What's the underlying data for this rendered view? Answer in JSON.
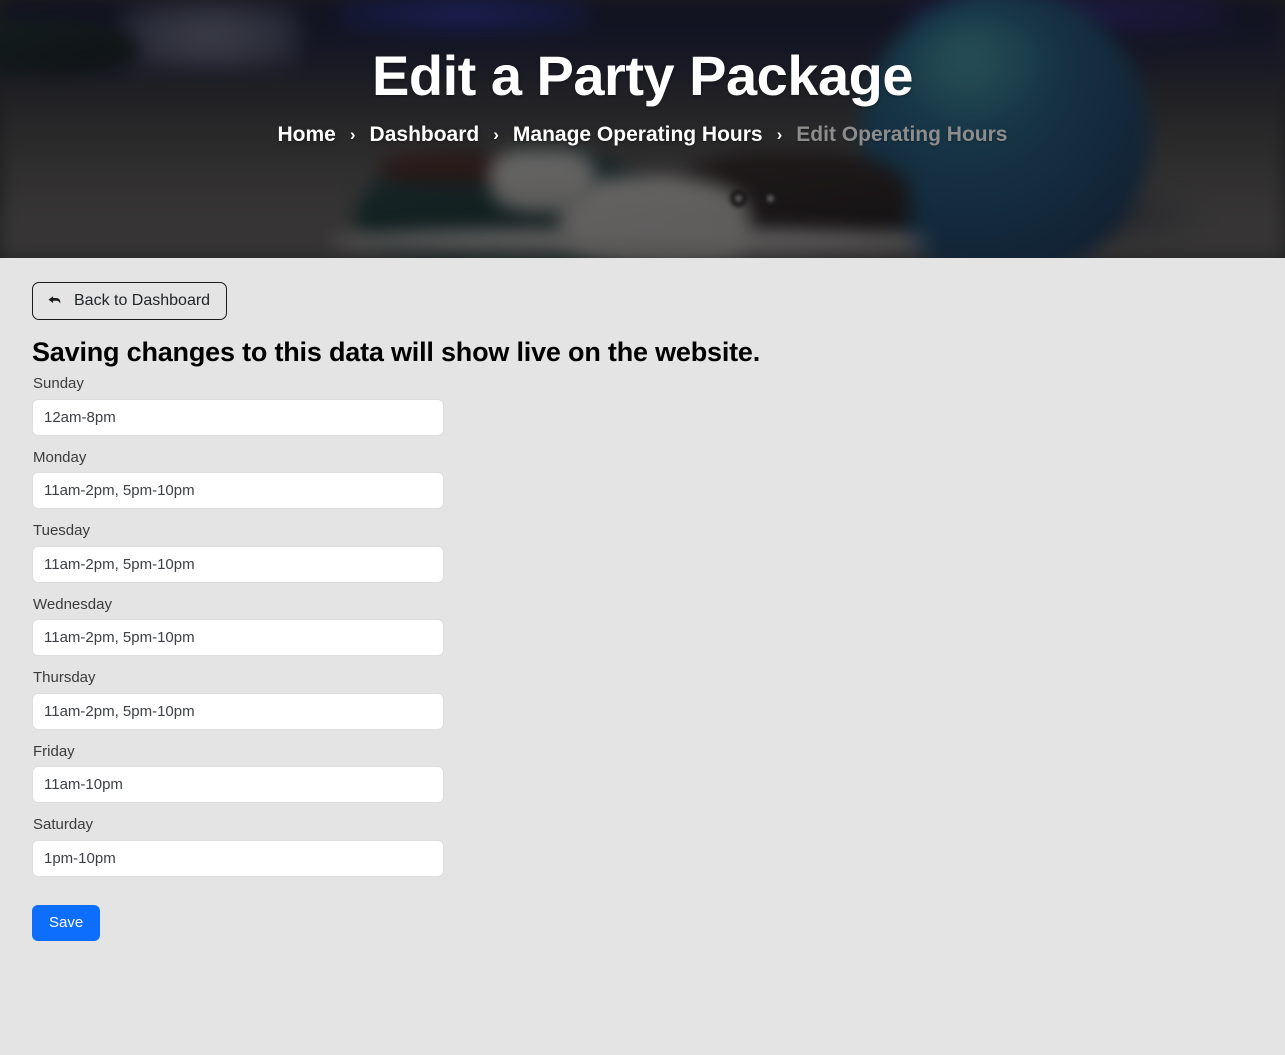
{
  "hero": {
    "title": "Edit a Party Package",
    "breadcrumb": {
      "separator": "›",
      "items": [
        {
          "label": "Home",
          "active": true
        },
        {
          "label": "Dashboard",
          "active": true
        },
        {
          "label": "Manage Operating Hours",
          "active": true
        },
        {
          "label": "Edit Operating Hours",
          "active": false
        }
      ]
    }
  },
  "main": {
    "back_button": {
      "label": "Back to Dashboard",
      "icon": "back-arrow-icon"
    },
    "heading": "Saving changes to this data will show live on the website.",
    "fields": [
      {
        "label": "Sunday",
        "value": "12am-8pm"
      },
      {
        "label": "Monday",
        "value": "11am-2pm, 5pm-10pm"
      },
      {
        "label": "Tuesday",
        "value": "11am-2pm, 5pm-10pm"
      },
      {
        "label": "Wednesday",
        "value": "11am-2pm, 5pm-10pm"
      },
      {
        "label": "Thursday",
        "value": "11am-2pm, 5pm-10pm"
      },
      {
        "label": "Friday",
        "value": "11am-10pm"
      },
      {
        "label": "Saturday",
        "value": "1pm-10pm"
      }
    ],
    "save_button": {
      "label": "Save"
    }
  },
  "colors": {
    "page_background": "#e4e4e4",
    "primary": "#0d6efd",
    "hero_overlay": "rgba(20,20,22,.62)",
    "text": "#212529",
    "inactive_crumb": "#8d8d8d"
  }
}
